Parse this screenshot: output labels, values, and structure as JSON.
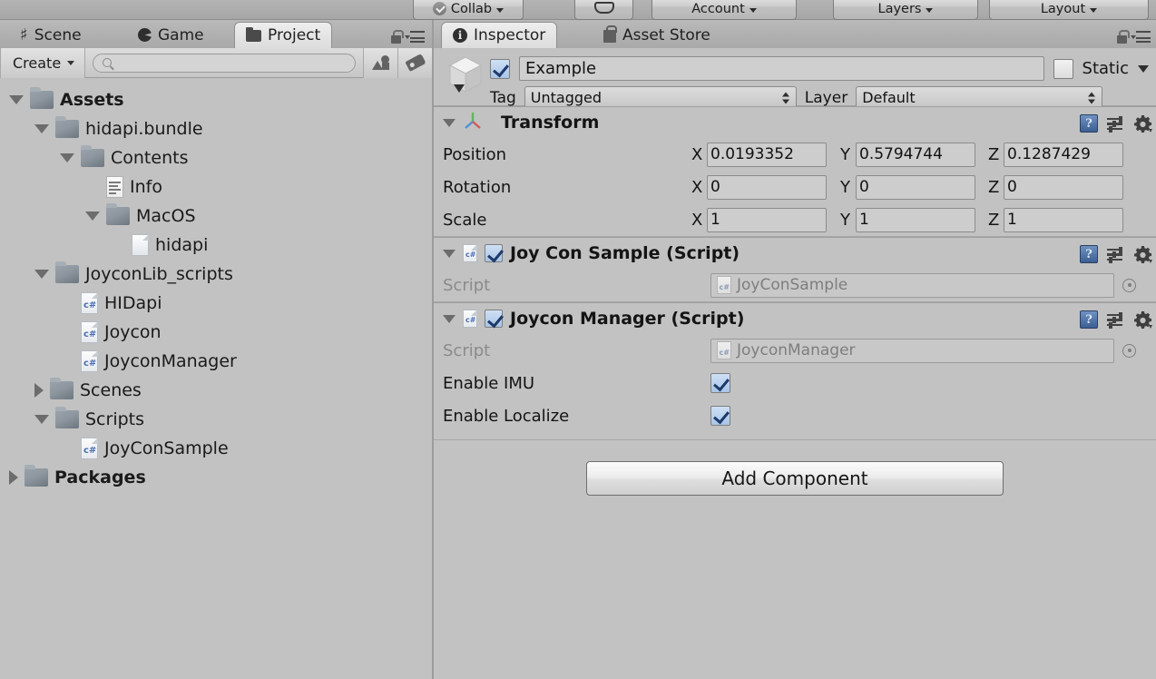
{
  "toolbar": {
    "buttons": [
      {
        "label": "Collab",
        "icon": "cloud-check-icon",
        "has_caret": true
      },
      {
        "label": "",
        "icon": "cloud-icon",
        "has_caret": false
      },
      {
        "label": "Account",
        "icon": "",
        "has_caret": true
      },
      {
        "label": "Layers",
        "icon": "",
        "has_caret": true
      },
      {
        "label": "Layout",
        "icon": "",
        "has_caret": true
      }
    ]
  },
  "project_panel": {
    "tabs": [
      {
        "label": "Scene",
        "icon": "grid-icon",
        "active": false
      },
      {
        "label": "Game",
        "icon": "pacman-icon",
        "active": false
      },
      {
        "label": "Project",
        "icon": "folder-icon",
        "active": true
      }
    ],
    "toolbar": {
      "create_label": "Create",
      "search_value": "",
      "search_placeholder": "",
      "search_icon": "search-icon",
      "filter_by_type_icon": "shape-filter-icon",
      "filter_by_label_icon": "tag-icon"
    },
    "lock_icon": "lock-icon",
    "menu_icon": "hamburger-menu-icon",
    "tree": [
      {
        "label": "Assets",
        "depth": 0,
        "toggle": "down",
        "icon": "folder",
        "bold": true
      },
      {
        "label": "hidapi.bundle",
        "depth": 1,
        "toggle": "down",
        "icon": "folder",
        "bold": false
      },
      {
        "label": "Contents",
        "depth": 2,
        "toggle": "down",
        "icon": "folder",
        "bold": false
      },
      {
        "label": "Info",
        "depth": 3,
        "toggle": "none",
        "icon": "plist",
        "bold": false
      },
      {
        "label": "MacOS",
        "depth": 3,
        "toggle": "down",
        "icon": "folder",
        "bold": false
      },
      {
        "label": "hidapi",
        "depth": 4,
        "toggle": "none",
        "icon": "file",
        "bold": false
      },
      {
        "label": "JoyconLib_scripts",
        "depth": 1,
        "toggle": "down",
        "icon": "folder",
        "bold": false
      },
      {
        "label": "HIDapi",
        "depth": 2,
        "toggle": "none",
        "icon": "cs",
        "bold": false
      },
      {
        "label": "Joycon",
        "depth": 2,
        "toggle": "none",
        "icon": "cs",
        "bold": false
      },
      {
        "label": "JoyconManager",
        "depth": 2,
        "toggle": "none",
        "icon": "cs",
        "bold": false
      },
      {
        "label": "Scenes",
        "depth": 1,
        "toggle": "right",
        "icon": "folder",
        "bold": false
      },
      {
        "label": "Scripts",
        "depth": 1,
        "toggle": "down",
        "icon": "folder",
        "bold": false
      },
      {
        "label": "JoyConSample",
        "depth": 2,
        "toggle": "none",
        "icon": "cs",
        "bold": false
      },
      {
        "label": "Packages",
        "depth": 0,
        "toggle": "right",
        "icon": "folder",
        "bold": true
      }
    ]
  },
  "inspector_panel": {
    "tabs": [
      {
        "label": "Inspector",
        "icon": "info-icon",
        "active": true
      },
      {
        "label": "Asset Store",
        "icon": "shopping-bag-icon",
        "active": false
      }
    ],
    "lock_icon": "lock-icon",
    "menu_icon": "hamburger-menu-icon",
    "gameobject": {
      "enabled": true,
      "name": "Example",
      "static_label": "Static",
      "static_checked": false,
      "tag_label": "Tag",
      "tag_value": "Untagged",
      "layer_label": "Layer",
      "layer_value": "Default"
    },
    "components": [
      {
        "title": "Transform",
        "icon": "transform-gizmo-icon",
        "expanded": true,
        "has_checkbox": false,
        "rows": [
          {
            "label": "Position",
            "axes": [
              {
                "axis": "X",
                "value": "0.0193352"
              },
              {
                "axis": "Y",
                "value": "0.5794744"
              },
              {
                "axis": "Z",
                "value": "0.1287429"
              }
            ]
          },
          {
            "label": "Rotation",
            "axes": [
              {
                "axis": "X",
                "value": "0"
              },
              {
                "axis": "Y",
                "value": "0"
              },
              {
                "axis": "Z",
                "value": "0"
              }
            ]
          },
          {
            "label": "Scale",
            "axes": [
              {
                "axis": "X",
                "value": "1"
              },
              {
                "axis": "Y",
                "value": "1"
              },
              {
                "axis": "Z",
                "value": "1"
              }
            ]
          }
        ]
      },
      {
        "title": "Joy Con Sample (Script)",
        "icon": "csharp-script-icon",
        "expanded": true,
        "has_checkbox": true,
        "checked": true,
        "script_label": "Script",
        "script_value": "JoyConSample",
        "properties": []
      },
      {
        "title": "Joycon Manager (Script)",
        "icon": "csharp-script-icon",
        "expanded": true,
        "has_checkbox": true,
        "checked": true,
        "script_label": "Script",
        "script_value": "JoyconManager",
        "properties": [
          {
            "label": "Enable IMU",
            "type": "checkbox",
            "checked": true
          },
          {
            "label": "Enable Localize",
            "type": "checkbox",
            "checked": true
          }
        ]
      }
    ],
    "add_component_label": "Add Component",
    "header_icons": {
      "help": "help-book-icon",
      "preset": "preset-icon",
      "settings": "gear-icon"
    }
  },
  "colors": {
    "panel_bg": "#c2c2c2",
    "tab_active_bg": "#e4e4e4",
    "field_bg": "#cdcdcd",
    "accent_blue": "#3c5f93"
  }
}
